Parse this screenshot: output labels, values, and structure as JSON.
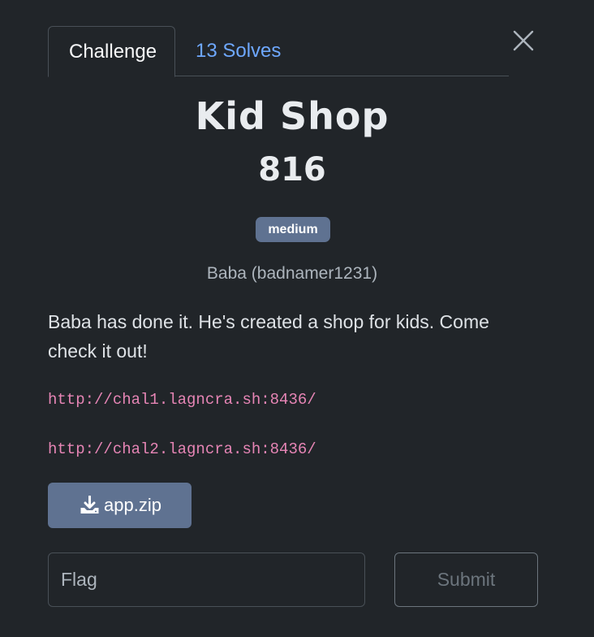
{
  "tabs": {
    "challenge_label": "Challenge",
    "solves_label": "13 Solves"
  },
  "challenge": {
    "name": "Kid Shop",
    "points": "816",
    "difficulty": "medium",
    "author": "Baba (badnamer1231)",
    "description": "Baba has done it. He's created a shop for kids. Come check it out!",
    "links": [
      "http://chal1.lagncra.sh:8436/",
      "http://chal2.lagncra.sh:8436/"
    ],
    "file_name": "app.zip"
  },
  "form": {
    "flag_placeholder": "Flag",
    "submit_label": "Submit"
  },
  "icons": {
    "close": "close-icon",
    "download": "download-icon"
  },
  "colors": {
    "background": "#212529",
    "accent_link": "#6ea8fe",
    "badge": "#5f7291",
    "url": "#e685b5"
  }
}
